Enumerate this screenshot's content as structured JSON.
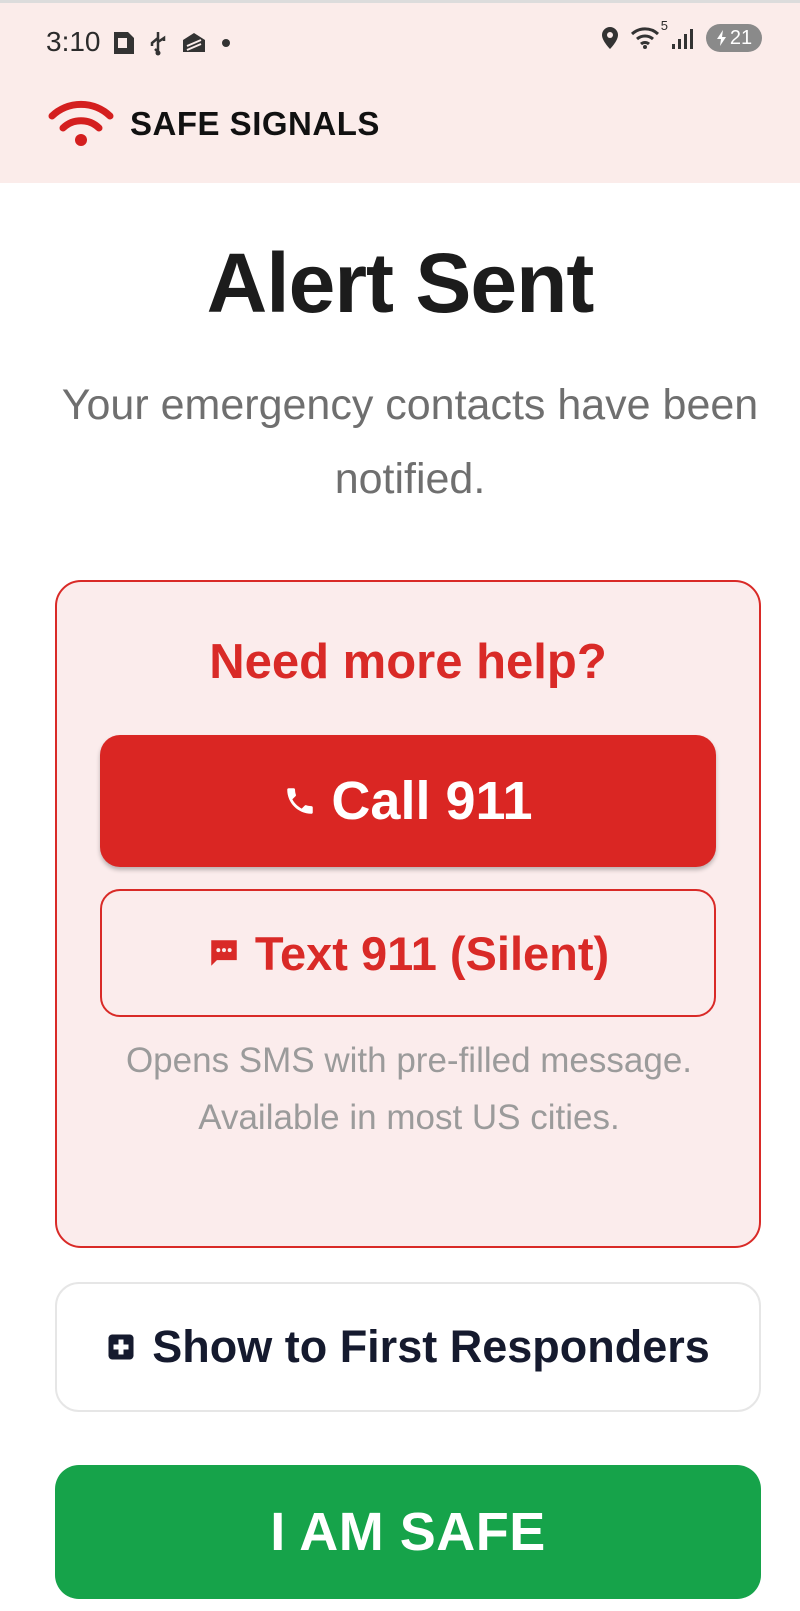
{
  "status_bar": {
    "time": "3:10",
    "battery_level": "21",
    "wifi_label": "5",
    "left_icons": [
      "sim-card-icon",
      "usb-icon",
      "app-notification-icon",
      "dot-icon"
    ],
    "right_icons": [
      "location-icon",
      "wifi-icon",
      "signal-icon",
      "battery-charging-icon"
    ]
  },
  "header": {
    "app_name": "SAFE SIGNALS",
    "logo_icon": "wifi-signal-logo-icon"
  },
  "main": {
    "title": "Alert Sent",
    "subtitle": "Your emergency contacts have been notified."
  },
  "help_card": {
    "title": "Need more help?",
    "call_button": {
      "label": "Call 911",
      "icon": "phone-icon"
    },
    "text_button": {
      "label": "Text 911 (Silent)",
      "icon": "message-icon"
    },
    "note": "Opens SMS with pre-filled message. Available in most US cities."
  },
  "responders_button": {
    "label": "Show to First Responders",
    "icon": "medical-cross-icon"
  },
  "safe_button": {
    "label": "I AM SAFE"
  },
  "colors": {
    "header_bg": "#fbecea",
    "accent_red": "#da2623",
    "card_bg": "#fbecec",
    "safe_green": "#16a34a",
    "subtitle_gray": "#6f6f6f"
  }
}
